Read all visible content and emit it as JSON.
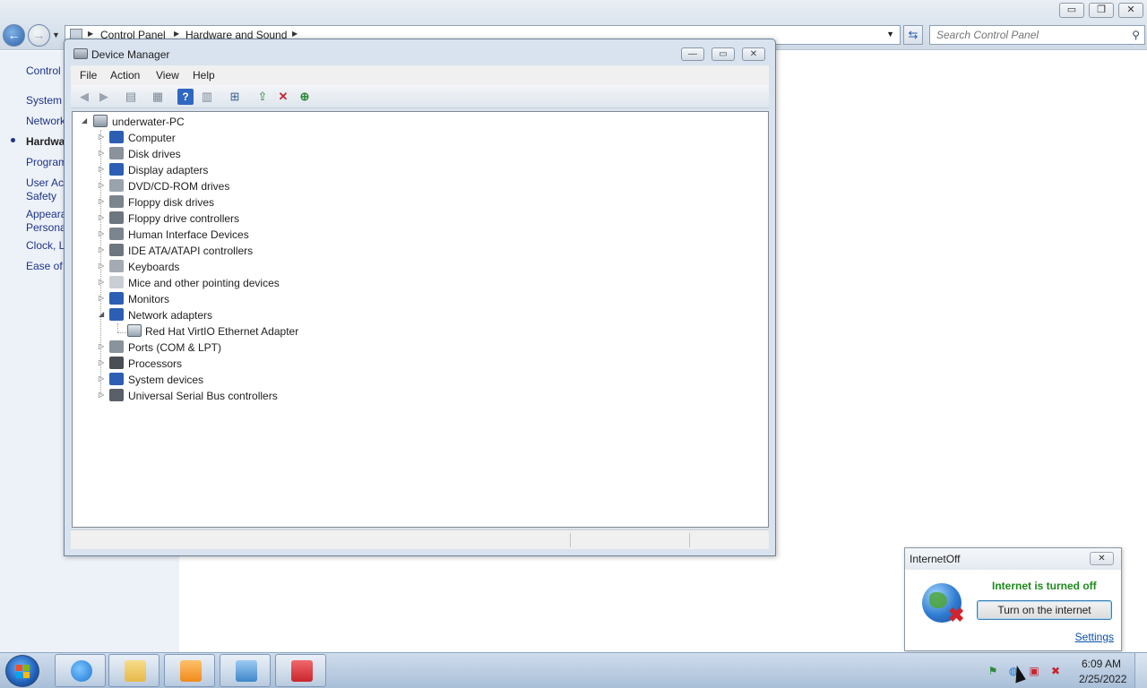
{
  "control_panel": {
    "caption_buttons": {
      "minimize": "▭",
      "restore": "❐",
      "close": "✕"
    },
    "breadcrumbs": [
      "Control Panel",
      "Hardware and Sound"
    ],
    "search_placeholder": "Search Control Panel",
    "sidebar": [
      {
        "label": "Control",
        "active": false
      },
      {
        "label": "System",
        "active": false
      },
      {
        "label": "Network",
        "active": false
      },
      {
        "label": "Hardwa",
        "active": true
      },
      {
        "label": "Program",
        "active": false
      },
      {
        "label": "User Acc",
        "active": false
      },
      {
        "label": "Safety",
        "active": false
      },
      {
        "label": "Appeara",
        "active": false
      },
      {
        "label": "Persona",
        "active": false
      },
      {
        "label": "Clock, L",
        "active": false
      },
      {
        "label": "Ease of A",
        "active": false
      }
    ]
  },
  "device_manager": {
    "title": "Device Manager",
    "caption_buttons": {
      "minimize": "—",
      "maximize": "▭",
      "close": "✕"
    },
    "menu": [
      "File",
      "Action",
      "View",
      "Help"
    ],
    "toolbar_icons": [
      "back-arrow-icon",
      "forward-arrow-icon",
      "show-hide-console-tree-icon",
      "properties-icon",
      "help-icon",
      "action-pane-icon",
      "scan-hardware-icon",
      "update-driver-icon",
      "uninstall-device-icon",
      "add-legacy-hardware-icon"
    ],
    "root": {
      "label": "underwater-PC",
      "expanded": true
    },
    "categories": [
      {
        "label": "Computer",
        "icon": "computer-icon",
        "color": "#2c5fb3"
      },
      {
        "label": "Disk drives",
        "icon": "disk-drive-icon",
        "color": "#8a929c"
      },
      {
        "label": "Display adapters",
        "icon": "display-adapter-icon",
        "color": "#2c5fb3"
      },
      {
        "label": "DVD/CD-ROM drives",
        "icon": "dvd-drive-icon",
        "color": "#9aa2ac"
      },
      {
        "label": "Floppy disk drives",
        "icon": "floppy-drive-icon",
        "color": "#7c848e"
      },
      {
        "label": "Floppy drive controllers",
        "icon": "floppy-controller-icon",
        "color": "#6e7680"
      },
      {
        "label": "Human Interface Devices",
        "icon": "hid-icon",
        "color": "#7c848e"
      },
      {
        "label": "IDE ATA/ATAPI controllers",
        "icon": "ide-controller-icon",
        "color": "#6e7680"
      },
      {
        "label": "Keyboards",
        "icon": "keyboard-icon",
        "color": "#a4abb3"
      },
      {
        "label": "Mice and other pointing devices",
        "icon": "mouse-icon",
        "color": "#c9ced4"
      },
      {
        "label": "Monitors",
        "icon": "monitor-icon",
        "color": "#2c5fb3"
      },
      {
        "label": "Network adapters",
        "icon": "network-adapter-icon",
        "color": "#2c5fb3",
        "expanded": true,
        "children": [
          "Red Hat VirtIO Ethernet Adapter"
        ]
      },
      {
        "label": "Ports (COM & LPT)",
        "icon": "port-icon",
        "color": "#8a929c"
      },
      {
        "label": "Processors",
        "icon": "processor-icon",
        "color": "#4a4f55"
      },
      {
        "label": "System devices",
        "icon": "system-device-icon",
        "color": "#2c5fb3"
      },
      {
        "label": "Universal Serial Bus controllers",
        "icon": "usb-icon",
        "color": "#5a6068"
      }
    ]
  },
  "internet_off": {
    "title": "InternetOff",
    "status": "Internet is turned off",
    "button": "Turn on the internet",
    "settings_link": "Settings",
    "close": "✕"
  },
  "taskbar": {
    "apps": [
      {
        "name": "internet-explorer",
        "color": "#1e78d2"
      },
      {
        "name": "windows-explorer",
        "color": "#e7b94a"
      },
      {
        "name": "media-player",
        "color": "#f08a1c"
      },
      {
        "name": "control-panel",
        "color": "#3e86c9"
      },
      {
        "name": "toolbox",
        "color": "#c9262c"
      }
    ],
    "clock_time": "6:09 AM",
    "clock_date": "2/25/2022"
  }
}
